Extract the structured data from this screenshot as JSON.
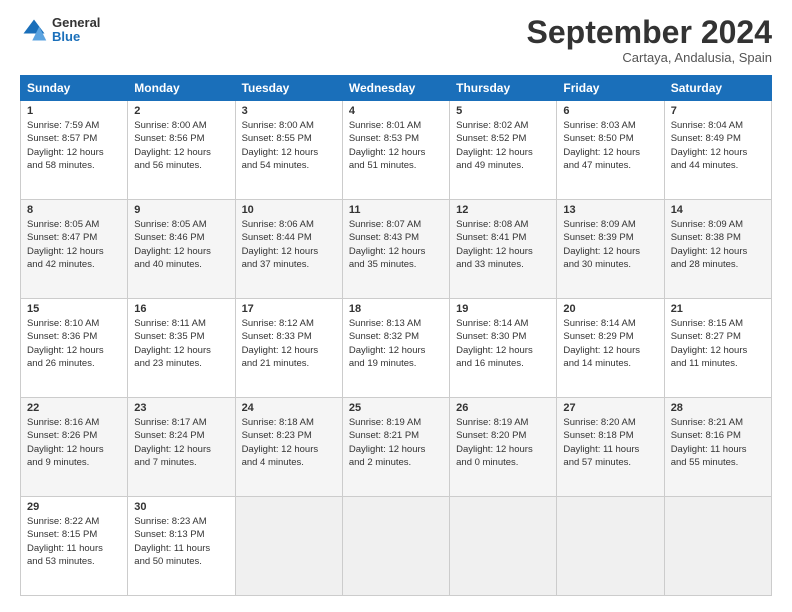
{
  "header": {
    "logo_general": "General",
    "logo_blue": "Blue",
    "month_title": "September 2024",
    "location": "Cartaya, Andalusia, Spain"
  },
  "calendar": {
    "days_of_week": [
      "Sunday",
      "Monday",
      "Tuesday",
      "Wednesday",
      "Thursday",
      "Friday",
      "Saturday"
    ],
    "weeks": [
      [
        {
          "day": "1",
          "sunrise": "7:59 AM",
          "sunset": "8:57 PM",
          "daylight": "12 hours and 58 minutes."
        },
        {
          "day": "2",
          "sunrise": "8:00 AM",
          "sunset": "8:56 PM",
          "daylight": "12 hours and 56 minutes."
        },
        {
          "day": "3",
          "sunrise": "8:00 AM",
          "sunset": "8:55 PM",
          "daylight": "12 hours and 54 minutes."
        },
        {
          "day": "4",
          "sunrise": "8:01 AM",
          "sunset": "8:53 PM",
          "daylight": "12 hours and 51 minutes."
        },
        {
          "day": "5",
          "sunrise": "8:02 AM",
          "sunset": "8:52 PM",
          "daylight": "12 hours and 49 minutes."
        },
        {
          "day": "6",
          "sunrise": "8:03 AM",
          "sunset": "8:50 PM",
          "daylight": "12 hours and 47 minutes."
        },
        {
          "day": "7",
          "sunrise": "8:04 AM",
          "sunset": "8:49 PM",
          "daylight": "12 hours and 44 minutes."
        }
      ],
      [
        {
          "day": "8",
          "sunrise": "8:05 AM",
          "sunset": "8:47 PM",
          "daylight": "12 hours and 42 minutes."
        },
        {
          "day": "9",
          "sunrise": "8:05 AM",
          "sunset": "8:46 PM",
          "daylight": "12 hours and 40 minutes."
        },
        {
          "day": "10",
          "sunrise": "8:06 AM",
          "sunset": "8:44 PM",
          "daylight": "12 hours and 37 minutes."
        },
        {
          "day": "11",
          "sunrise": "8:07 AM",
          "sunset": "8:43 PM",
          "daylight": "12 hours and 35 minutes."
        },
        {
          "day": "12",
          "sunrise": "8:08 AM",
          "sunset": "8:41 PM",
          "daylight": "12 hours and 33 minutes."
        },
        {
          "day": "13",
          "sunrise": "8:09 AM",
          "sunset": "8:39 PM",
          "daylight": "12 hours and 30 minutes."
        },
        {
          "day": "14",
          "sunrise": "8:09 AM",
          "sunset": "8:38 PM",
          "daylight": "12 hours and 28 minutes."
        }
      ],
      [
        {
          "day": "15",
          "sunrise": "8:10 AM",
          "sunset": "8:36 PM",
          "daylight": "12 hours and 26 minutes."
        },
        {
          "day": "16",
          "sunrise": "8:11 AM",
          "sunset": "8:35 PM",
          "daylight": "12 hours and 23 minutes."
        },
        {
          "day": "17",
          "sunrise": "8:12 AM",
          "sunset": "8:33 PM",
          "daylight": "12 hours and 21 minutes."
        },
        {
          "day": "18",
          "sunrise": "8:13 AM",
          "sunset": "8:32 PM",
          "daylight": "12 hours and 19 minutes."
        },
        {
          "day": "19",
          "sunrise": "8:14 AM",
          "sunset": "8:30 PM",
          "daylight": "12 hours and 16 minutes."
        },
        {
          "day": "20",
          "sunrise": "8:14 AM",
          "sunset": "8:29 PM",
          "daylight": "12 hours and 14 minutes."
        },
        {
          "day": "21",
          "sunrise": "8:15 AM",
          "sunset": "8:27 PM",
          "daylight": "12 hours and 11 minutes."
        }
      ],
      [
        {
          "day": "22",
          "sunrise": "8:16 AM",
          "sunset": "8:26 PM",
          "daylight": "12 hours and 9 minutes."
        },
        {
          "day": "23",
          "sunrise": "8:17 AM",
          "sunset": "8:24 PM",
          "daylight": "12 hours and 7 minutes."
        },
        {
          "day": "24",
          "sunrise": "8:18 AM",
          "sunset": "8:23 PM",
          "daylight": "12 hours and 4 minutes."
        },
        {
          "day": "25",
          "sunrise": "8:19 AM",
          "sunset": "8:21 PM",
          "daylight": "12 hours and 2 minutes."
        },
        {
          "day": "26",
          "sunrise": "8:19 AM",
          "sunset": "8:20 PM",
          "daylight": "12 hours and 0 minutes."
        },
        {
          "day": "27",
          "sunrise": "8:20 AM",
          "sunset": "8:18 PM",
          "daylight": "11 hours and 57 minutes."
        },
        {
          "day": "28",
          "sunrise": "8:21 AM",
          "sunset": "8:16 PM",
          "daylight": "11 hours and 55 minutes."
        }
      ],
      [
        {
          "day": "29",
          "sunrise": "8:22 AM",
          "sunset": "8:15 PM",
          "daylight": "11 hours and 53 minutes."
        },
        {
          "day": "30",
          "sunrise": "8:23 AM",
          "sunset": "8:13 PM",
          "daylight": "11 hours and 50 minutes."
        },
        null,
        null,
        null,
        null,
        null
      ]
    ]
  }
}
